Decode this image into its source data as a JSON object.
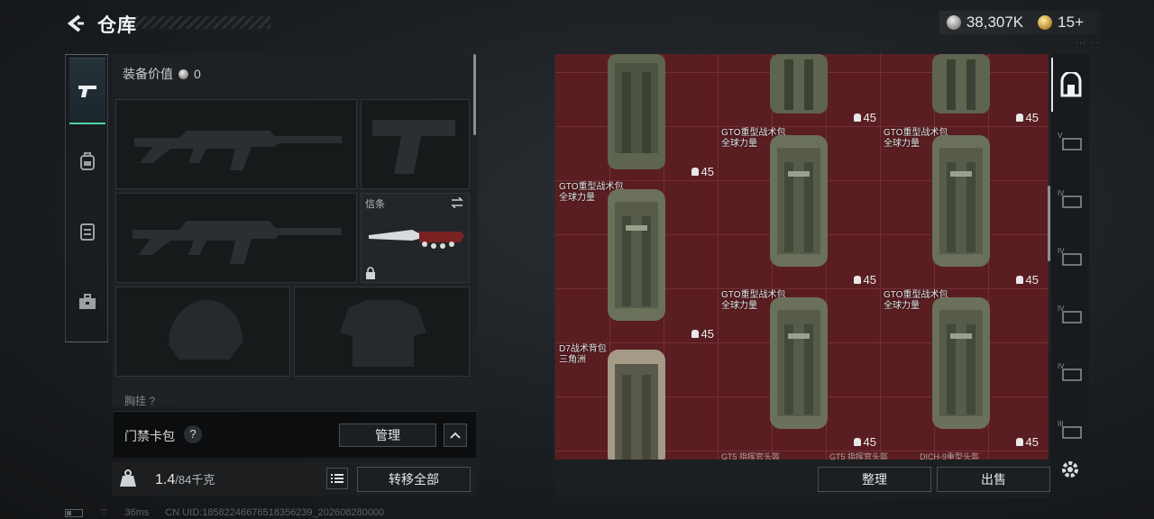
{
  "header": {
    "title": "仓库",
    "currency": [
      {
        "icon": "silver-coin-icon",
        "value": "38,307K"
      },
      {
        "icon": "gold-coin-icon",
        "value": "15+"
      }
    ],
    "sub_text": "··· · ·"
  },
  "left_tabs": [
    {
      "name": "weapon",
      "icon": "pistol-icon",
      "active": true
    },
    {
      "name": "backpack",
      "icon": "backpack-icon",
      "active": false
    },
    {
      "name": "vest",
      "icon": "vest-icon",
      "active": false
    },
    {
      "name": "case",
      "icon": "toolbox-icon",
      "active": false
    }
  ],
  "equipment": {
    "value_label": "装备价值",
    "value": "0",
    "melee_label": "信条",
    "bottom_label": "胸挂 ?"
  },
  "keycard": {
    "label": "门禁卡包",
    "help": "?",
    "manage_label": "管理"
  },
  "weight": {
    "current": "1.4",
    "max": "/84千克",
    "transfer_label": "转移全部"
  },
  "status": {
    "ping": "36ms",
    "uid": "CN UID:185822466765183562​39_202608280000"
  },
  "storage": {
    "items": [
      {
        "name": "",
        "sub": "",
        "qty": "45"
      },
      {
        "name": "",
        "sub": "",
        "qty": "45"
      },
      {
        "name": "",
        "sub": "",
        "qty": "45"
      },
      {
        "name": "GTO重型战术包",
        "sub": "全球力量",
        "qty": "45"
      },
      {
        "name": "GTO重型战术包",
        "sub": "全球力量",
        "qty": "45"
      },
      {
        "name": "GTO重型战术包",
        "sub": "全球力量",
        "qty": "45"
      },
      {
        "name": "GTO重型战术包",
        "sub": "全球力量",
        "qty": "45"
      },
      {
        "name": "GTO重型战术包",
        "sub": "全球力量",
        "qty": "45"
      },
      {
        "name": "D7战术背包",
        "sub": "三角洲",
        "qty": ""
      }
    ],
    "peek_labels": [
      "GT5 指挥官头盔",
      "GT5 指挥官头盔",
      "DICH-9重型头盔"
    ],
    "organize_label": "整理",
    "sell_label": "出售"
  },
  "right_tabs": [
    {
      "icon": "storage-icon",
      "tier": ""
    },
    {
      "icon": "tier-item-icon",
      "tier": "V"
    },
    {
      "icon": "tier-item-icon",
      "tier": "IV"
    },
    {
      "icon": "tier-item-icon",
      "tier": "IV"
    },
    {
      "icon": "tier-item-icon",
      "tier": "IV"
    },
    {
      "icon": "tier-item-icon",
      "tier": "IV"
    },
    {
      "icon": "tier-item-icon",
      "tier": "III"
    }
  ],
  "colors": {
    "accent": "#4fd1a8",
    "storage_bg": "#5a1d21",
    "panel_bg": "#1e2225"
  }
}
